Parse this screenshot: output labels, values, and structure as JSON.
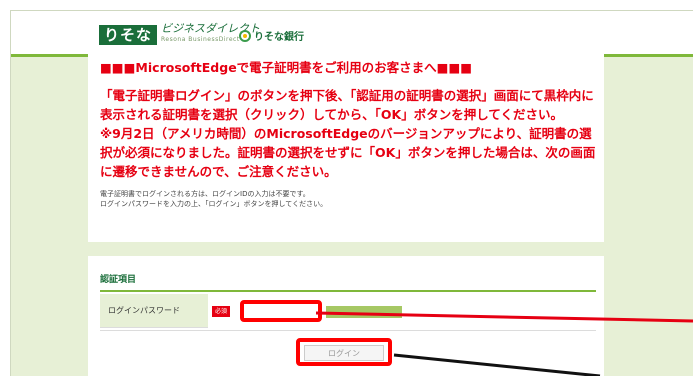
{
  "header": {
    "logo_text": "りそな",
    "brand_name": "ビジネスダイレクト",
    "brand_sub": "Resona BusinessDirect",
    "bank_name": "りそな銀行"
  },
  "notice": {
    "title": "■■■MicrosoftEdgeで電子証明書をご利用のお客さまへ■■■",
    "lines": [
      "「電子証明書ログイン」のボタンを押下後、「認証用の証明書の選択」画面にて黒枠内に",
      "表示される証明書を選択（クリック）してから、「OK」ボタンを押してください。",
      "※9月2日（アメリカ時間）のMicrosoftEdgeのバージョンアップにより、証明書の選",
      "択が必須になりました。証明書の選択をせずに「OK」ボタンを押した場合は、次の画面",
      "に遷移できませんので、ご注意ください。"
    ],
    "small_lines": [
      "電子証明書でログインされる方は、ログインIDの入力は不要です。",
      "ログインパスワードを入力の上、「ログイン」ボタンを押してください。"
    ]
  },
  "auth": {
    "section_title": "認証項目",
    "password_label": "ログインパスワード",
    "required_badge": "必須",
    "password_value": "",
    "login_button_label": "ログイン"
  },
  "colors": {
    "accent_red": "#e60012",
    "highlight_red": "#ff0000",
    "brand_green": "#1a6e3a",
    "bar_green": "#7fb83a",
    "background_green": "#e7f0d6"
  }
}
